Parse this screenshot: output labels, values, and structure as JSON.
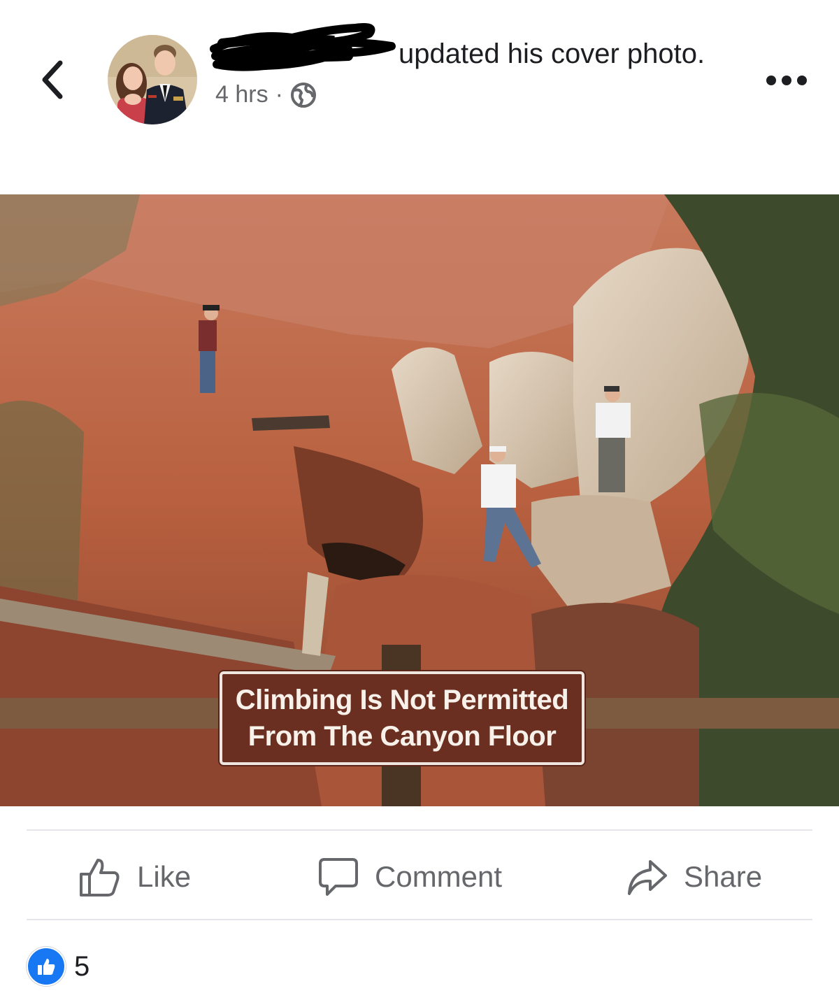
{
  "header": {
    "author_redacted": true,
    "action_text": "updated his cover photo.",
    "timestamp": "4 hrs",
    "separator": "·",
    "privacy_icon": "globe-icon"
  },
  "photo": {
    "sign_line1": "Climbing Is Not Permitted",
    "sign_line2": "From The Canyon Floor"
  },
  "actions": {
    "like_label": "Like",
    "comment_label": "Comment",
    "share_label": "Share"
  },
  "reactions": {
    "type_icon": "thumbs-up-icon",
    "count": "5"
  },
  "colors": {
    "text_primary": "#1c1e21",
    "text_secondary": "#65676b",
    "divider": "#e4e6eb",
    "like_blue": "#1877f2",
    "sign_brown": "#6b2f22"
  }
}
